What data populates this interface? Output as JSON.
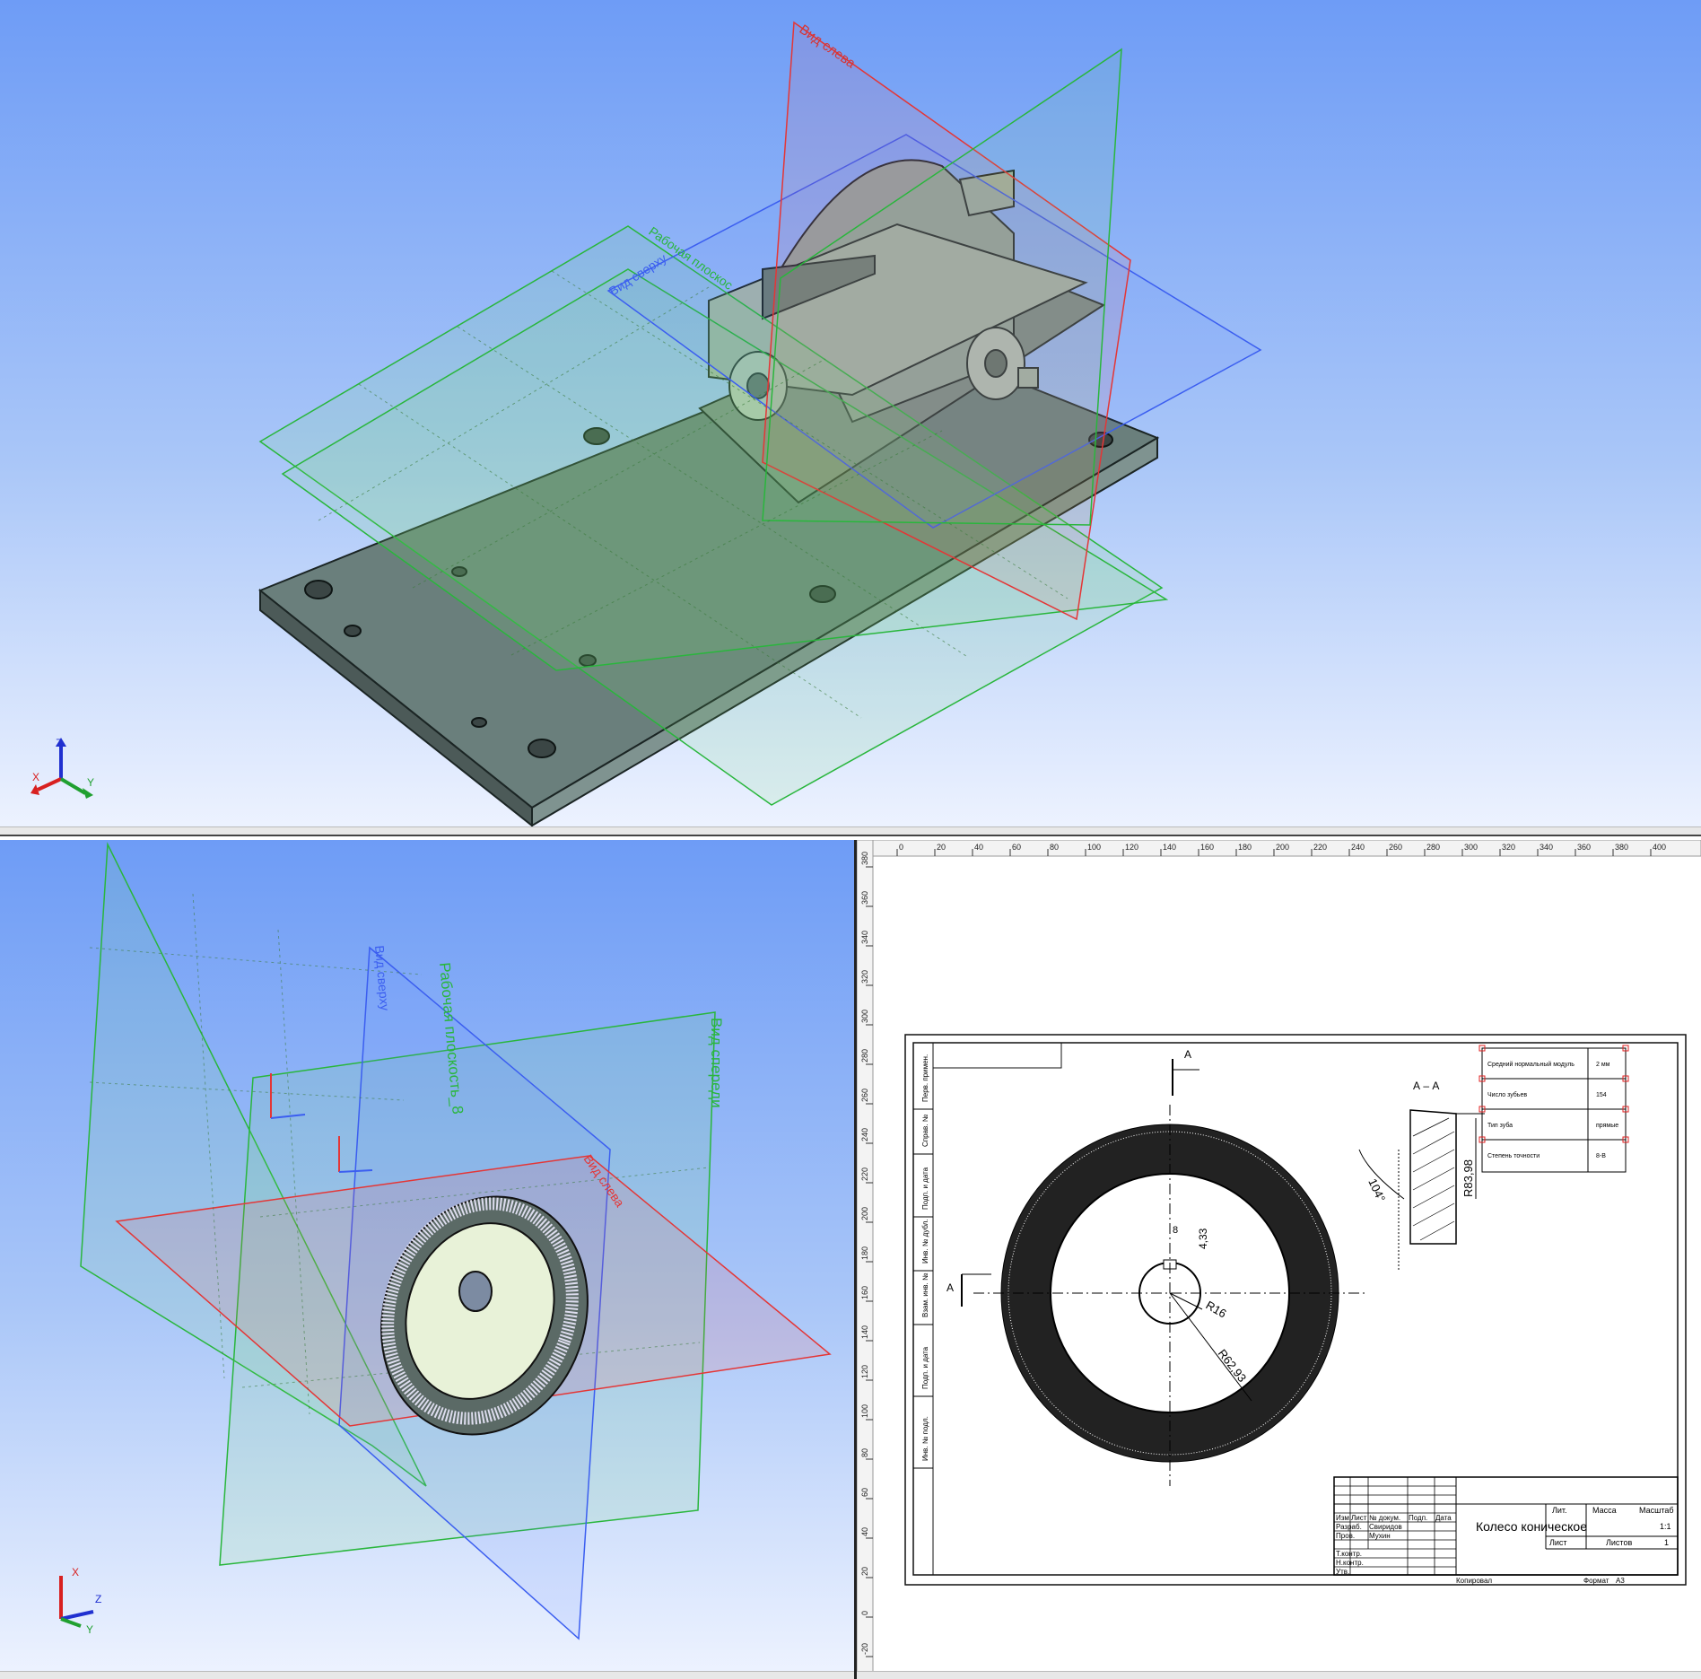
{
  "top_view": {
    "plane_labels": {
      "left": "Вид слева",
      "top": "Вид сверху",
      "work_plane": "Рабочая плоскос"
    },
    "axes": {
      "x": "X",
      "y": "Y",
      "z": "Z"
    }
  },
  "bottom_left_view": {
    "plane_labels": {
      "front": "Вид спереди",
      "work_plane": "Рабочая плоскость_8",
      "top": "Вид сверху",
      "left": "Вид слева"
    },
    "axes": {
      "x": "X",
      "y": "Y",
      "z": "Z"
    }
  },
  "drawing": {
    "ruler_top": [
      "0",
      "20",
      "40",
      "60",
      "80",
      "100",
      "120",
      "140",
      "160",
      "180",
      "200",
      "220",
      "240",
      "260",
      "280",
      "300",
      "320",
      "340",
      "360",
      "380",
      "400"
    ],
    "ruler_left": [
      "380",
      "360",
      "340",
      "320",
      "300",
      "280",
      "260",
      "240",
      "220",
      "200",
      "180",
      "160",
      "140",
      "120",
      "100",
      "80",
      "60",
      "40",
      "20",
      "0",
      "-20"
    ],
    "section_mark": "А",
    "section_title": "А – А",
    "dims": {
      "r16": "R16",
      "r62": "R62,93",
      "d433": "4,33",
      "d8": "8",
      "angle": "104°",
      "r83": "R83,98"
    },
    "params_table": [
      {
        "name": "Средний нормальный модуль",
        "value": "2 мм"
      },
      {
        "name": "Число зубьев",
        "value": "154"
      },
      {
        "name": "Тип зуба",
        "value": "прямые"
      },
      {
        "name": "Степень точности",
        "value": "8-В"
      }
    ],
    "side_stamps": [
      "Перв. примен.",
      "Справ. №",
      "Подп. и дата",
      "Инв. № дубл.",
      "Взам. инв. №",
      "Подп. и дата",
      "Инв. № подл."
    ],
    "title_block": {
      "name": "Колесо коническое",
      "rows": [
        "Изм.",
        "Разраб.",
        "Пров.",
        "Т.контр.",
        "Н.контр.",
        "Утв."
      ],
      "cols": [
        "Лист",
        "№ докум.",
        "Подп.",
        "Дата"
      ],
      "developer": "Свиридов",
      "checker": "Мухин",
      "lit": "Лит.",
      "mass": "Масса",
      "scale": "Масштаб",
      "scale_value": "1:1",
      "sheet": "Лист",
      "sheets": "Листов",
      "sheets_value": "1",
      "copied": "Копировал",
      "format": "Формат",
      "format_value": "A3"
    }
  }
}
